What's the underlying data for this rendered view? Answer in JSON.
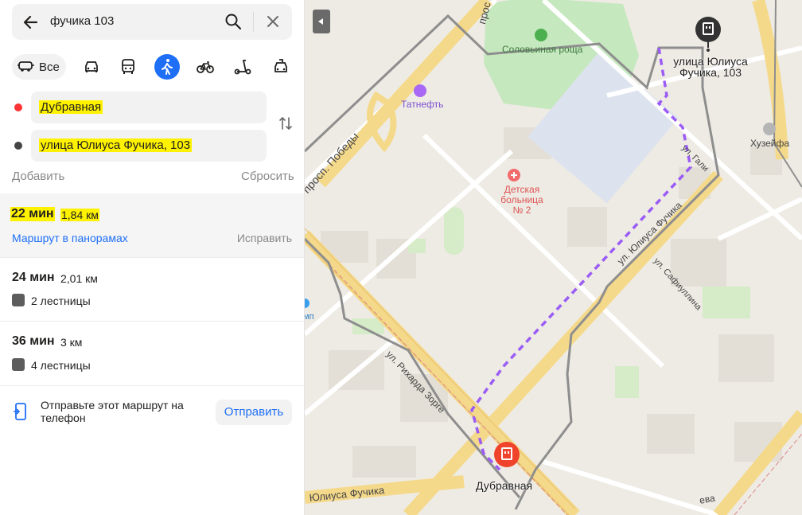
{
  "search": {
    "query": "фучика 103"
  },
  "modes": {
    "all_label": "Все"
  },
  "from": {
    "label": "Дубравная"
  },
  "to": {
    "label": "улица Юлиуса Фучика, 103"
  },
  "actions": {
    "add": "Добавить",
    "reset": "Сбросить"
  },
  "routes": [
    {
      "time": "22 мин",
      "distance": "1,84 км",
      "pano": "Маршрут в панорамах",
      "fix": "Исправить"
    },
    {
      "time": "24 мин",
      "distance": "2,01 км",
      "stairs": "2 лестницы"
    },
    {
      "time": "36 мин",
      "distance": "3 км",
      "stairs": "4 лестницы"
    }
  ],
  "send": {
    "text": "Отправьте этот маршрут на телефон",
    "button": "Отправить"
  },
  "map": {
    "labels": {
      "park": "Соловьиная роща",
      "gas": "Татнефть",
      "hospital": "Детская больница № 2",
      "mosque": "Хузейфа",
      "pobedy": "просп. Победы",
      "pros": "прос",
      "fuchika_diag": "ул. Юлиуса Фучика",
      "fuchika_bottom": "Юлиуса Фучика",
      "zorge": "ул. Рихарда Зорге",
      "safiullina": "ул. Сафиуллина",
      "gali": "ул. Гали",
      "mp": "мп",
      "eva": "ева"
    },
    "dest_label": "улица Юлиуса Фучика, 103",
    "start_label": "Дубравная"
  }
}
